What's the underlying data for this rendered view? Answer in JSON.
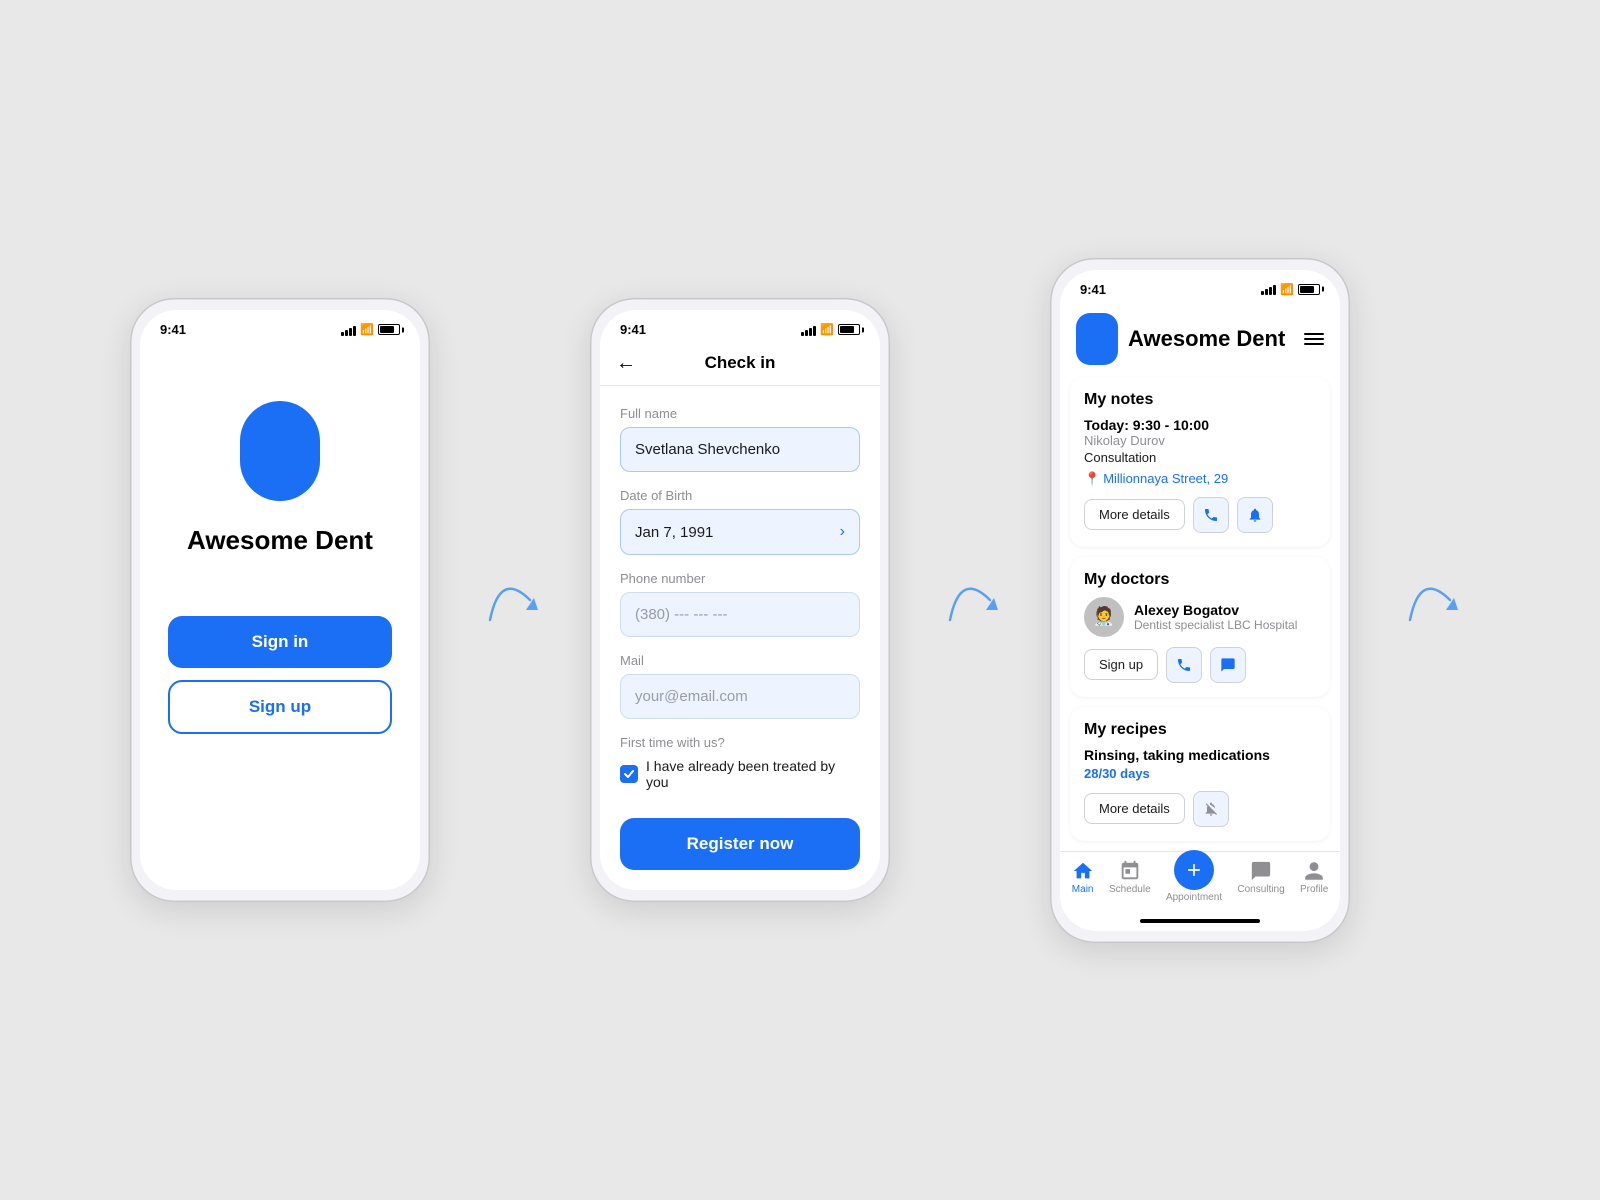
{
  "app": {
    "name": "Awesome Dent"
  },
  "screen1": {
    "time": "9:41",
    "signin_label": "Sign in",
    "signup_label": "Sign up"
  },
  "screen2": {
    "time": "9:41",
    "title": "Check in",
    "full_name_label": "Full name",
    "full_name_value": "Svetlana Shevchenko",
    "dob_label": "Date of Birth",
    "dob_value": "Jan 7, 1991",
    "phone_label": "Phone number",
    "phone_placeholder": "(380) --- --- ---",
    "mail_label": "Mail",
    "mail_placeholder": "your@email.com",
    "first_time_label": "First time with us?",
    "checkbox_label": "I have already been treated by you",
    "register_label": "Register now"
  },
  "screen3": {
    "time": "9:41",
    "app_title": "Awesome Dent",
    "notes_section": "My notes",
    "notes_time": "Today: 9:30 - 10:00",
    "notes_doctor": "Nikolay Durov",
    "notes_type": "Consultation",
    "notes_location": "Millionnaya Street, 29",
    "more_details_label": "More details",
    "doctors_section": "My doctors",
    "doctor_name": "Alexey Bogatov",
    "doctor_spec": "Dentist specialist LBC Hospital",
    "signup_label": "Sign up",
    "recipes_section": "My recipes",
    "recipe_name": "Rinsing, taking medications",
    "recipe_days": "28/30 days",
    "recipe_details": "More details",
    "nav_main": "Main",
    "nav_schedule": "Schedule",
    "nav_appointment": "Appointment",
    "nav_consulting": "Consulting",
    "nav_profile": "Profile"
  }
}
